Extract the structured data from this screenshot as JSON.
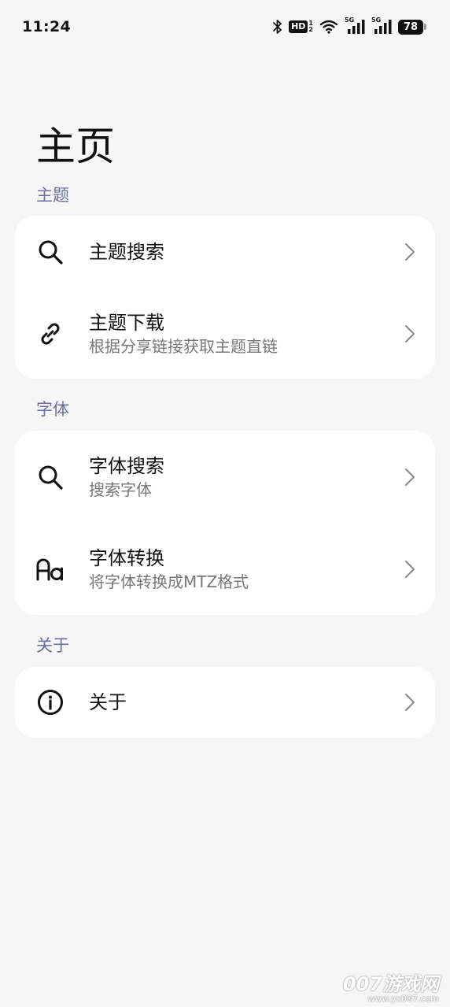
{
  "status_bar": {
    "time": "11:24",
    "hd_label": "HD",
    "hd_top": "1",
    "hd_bottom": "2",
    "signal1_label": "5G",
    "signal2_label": "5G",
    "battery": "78"
  },
  "page": {
    "title": "主页"
  },
  "sections": [
    {
      "label": "主题",
      "items": [
        {
          "icon": "search-icon",
          "title": "主题搜索",
          "subtitle": ""
        },
        {
          "icon": "link-icon",
          "title": "主题下载",
          "subtitle": "根据分享链接获取主题直链"
        }
      ]
    },
    {
      "label": "字体",
      "items": [
        {
          "icon": "search-icon",
          "title": "字体搜索",
          "subtitle": "搜索字体"
        },
        {
          "icon": "font-aa-icon",
          "title": "字体转换",
          "subtitle": "将字体转换成MTZ格式"
        }
      ]
    },
    {
      "label": "关于",
      "items": [
        {
          "icon": "info-icon",
          "title": "关于",
          "subtitle": ""
        }
      ]
    }
  ],
  "watermark": {
    "main": "007游戏网",
    "url": "www.yx007.com"
  }
}
